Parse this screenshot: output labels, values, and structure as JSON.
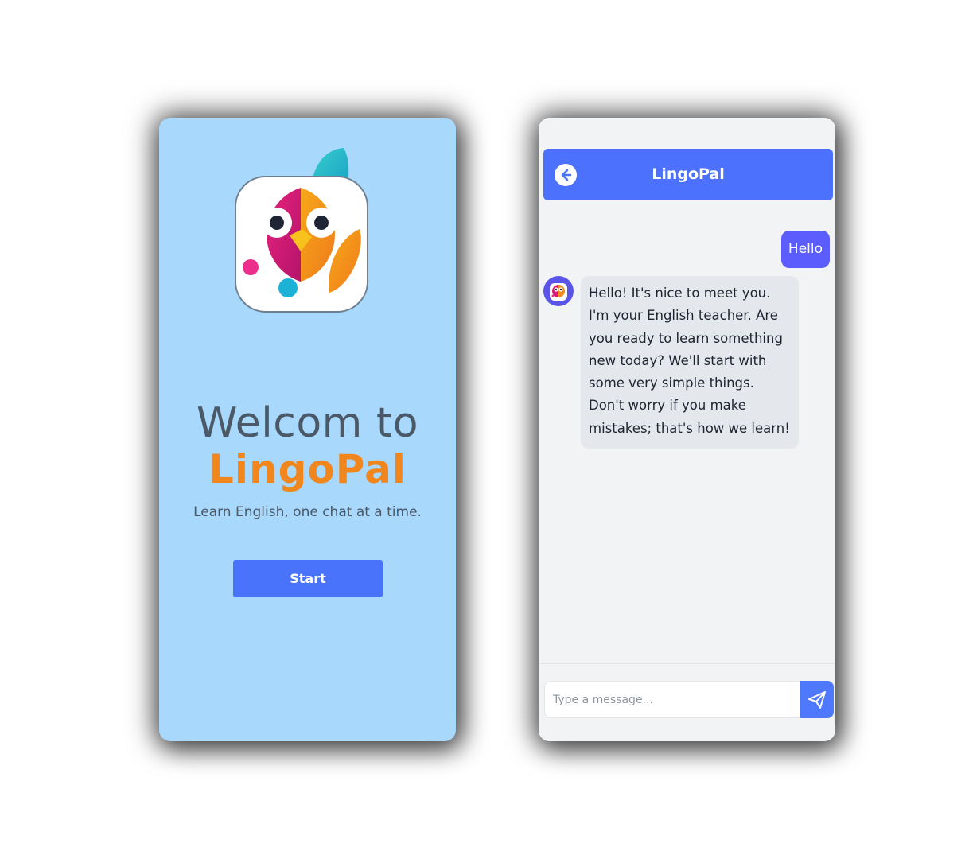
{
  "welcome_screen": {
    "title_line": "Welcom to",
    "brand_name": "LingoPal",
    "tagline": "Learn English, one chat at a time.",
    "start_button": "Start"
  },
  "chat_screen": {
    "header_title": "LingoPal",
    "messages": [
      {
        "role": "user",
        "text": "Hello"
      },
      {
        "role": "bot",
        "text": "Hello! It's nice to meet you. I'm your English teacher. Are you ready to learn something new today? We'll start with some very simple things. Don't worry if you make mistakes; that's how we learn!"
      }
    ],
    "input_placeholder": "Type a message..."
  },
  "icons": {
    "logo": "owl-logo-icon",
    "back": "arrow-left-circle-icon",
    "send": "send-paper-plane-icon",
    "avatar": "owl-avatar-icon"
  },
  "colors": {
    "welcome_background": "#a8d8fc",
    "brand_orange": "#f0861c",
    "primary_blue": "#4a73fb",
    "user_bubble": "#5c5dfd",
    "bot_bubble": "#e4e7ec",
    "chat_background": "#f2f3f5"
  }
}
